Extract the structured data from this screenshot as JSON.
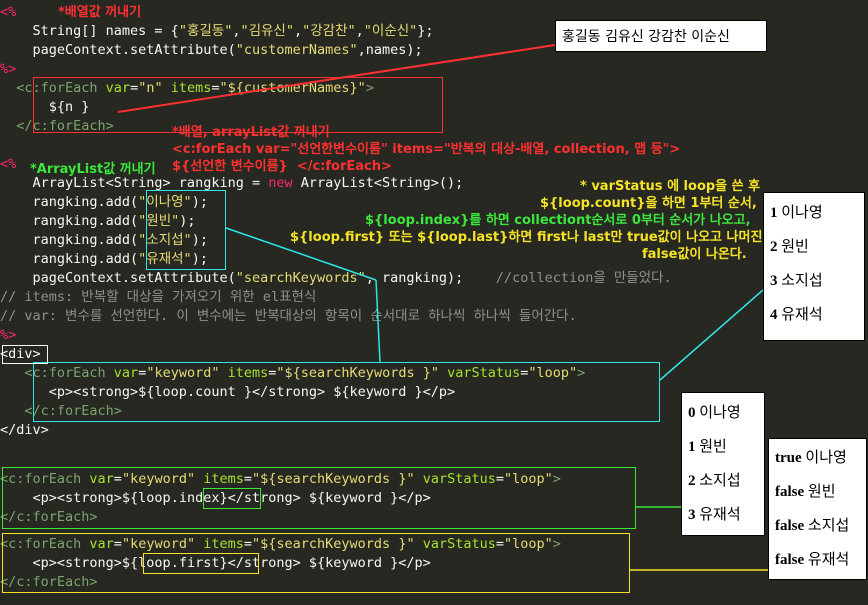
{
  "annotations": {
    "array_title": "*배열값 꺼내기",
    "foreach_title": "*배열, arrayList값 꺼내기",
    "foreach_syntax1": "<c:forEach var=\"선언한변수이름\" items=\"반복의 대상-배열, collection, 맵 등\">",
    "foreach_syntax2": "${선언한 변수이름}  </c:forEach>",
    "arraylist_title": "*ArrayList값 꺼내기",
    "varstatus1": "* varStatus 에 loop을 쓴 후",
    "varstatus2": "${loop.count}을 하면 1부터 순서,",
    "varstatus3": "${loop.index}를 하면 collectiont순서로 0부터 순서가 나오고,",
    "varstatus4": "${loop.first} 또는 ${loop.last}하면 first나 last만 true값이 나오고 나머진",
    "varstatus5": "false값이 나온다."
  },
  "code": {
    "l_open1": "<%",
    "l_names_a": "    String[] names = {",
    "l_names_s1": "\"홍길동\"",
    "l_names_s2": "\"김유신\"",
    "l_names_s3": "\"강감찬\"",
    "l_names_s4": "\"이순신\"",
    "l_names_end": "};",
    "l_setattr1_a": "    pageContext.setAttribute(",
    "l_setattr1_s": "\"customerNames\"",
    "l_setattr1_b": ",names);",
    "l_close1": "%>",
    "l_fe1_tag": "  <c:forEach ",
    "l_fe1_var": "var",
    "l_fe1_varval": "\"n\"",
    "l_fe1_items": " items",
    "l_fe1_itemsval": "\"${customerNames}\"",
    "l_fe1_end": ">",
    "l_fe1_body": "      ${n }",
    "l_fe1_close": "  </c:forEach>",
    "l_open2": "<%",
    "l_al_a": "    ArrayList<String> rangking = ",
    "l_al_new": "new",
    "l_al_b": " ArrayList<String>();",
    "l_add_a": "    rangking.add(",
    "l_add_v1": "\"이나영\"",
    "l_add_v2": "\"원빈\"",
    "l_add_v3": "\"소지섭\"",
    "l_add_v4": "\"유재석\"",
    "l_add_end": ");",
    "l_setattr2_a": "    pageContext.setAttribute(",
    "l_setattr2_s": "\"searchKeywords\"",
    "l_setattr2_b": ", rangking);",
    "l_setattr2_cmt": "    //collection을 만들었다.",
    "l_cmt1": "// items: 반복할 대상을 가져오기 위한 el표현식",
    "l_cmt2": "// var: 변수를 선언한다. 이 변수에는 반복대상의 항목이 순서대로 하나씩 하나씩 들어간다.",
    "l_close2": "%>",
    "l_div_open": "<div>",
    "l_fe2_tag": "   <c:forEach ",
    "l_fe_var": "var",
    "l_fe_varval": "\"keyword\"",
    "l_fe_items": " items",
    "l_fe_itemsval": "\"${searchKeywords }\"",
    "l_fe_vs": " varStatus",
    "l_fe_vsval": "\"loop\"",
    "l_fe_end": ">",
    "l_fe2_body_a": "      <p><strong>",
    "l_fe2_body_el": "${loop.count }",
    "l_fe2_body_b": "</strong> ",
    "l_fe2_body_el2": "${keyword }",
    "l_fe2_body_c": "</p>",
    "l_fe2_close": "   </c:forEach>",
    "l_div_close": "</div>",
    "l_fe3_tag": "<c:forEach ",
    "l_fe3_body_a": "    <p><strong>",
    "l_fe3_body_el": "${loop.index}",
    "l_fe3_body_b": "</strong> ",
    "l_fe3_body_el2": "${keyword }",
    "l_fe3_body_c": "</p>",
    "l_fe3_close": "</c:forEach>",
    "l_fe4_tag": "<c:forEach ",
    "l_fe4_body_a": "    <p><strong>",
    "l_fe4_body_el": "${loop.first}",
    "l_fe4_body_b": "</strong> ",
    "l_fe4_body_el2": "${keyword }",
    "l_fe4_body_c": "</p>",
    "l_fe4_close": "</c:forEach>"
  },
  "popups": {
    "names_output": "홍길동 김유신 강감찬 이순신",
    "count_output": [
      {
        "num": "1",
        "name": "이나영"
      },
      {
        "num": "2",
        "name": "원빈"
      },
      {
        "num": "3",
        "name": "소지섭"
      },
      {
        "num": "4",
        "name": "유재석"
      }
    ],
    "index_output": [
      {
        "num": "0",
        "name": "이나영"
      },
      {
        "num": "1",
        "name": "원빈"
      },
      {
        "num": "2",
        "name": "소지섭"
      },
      {
        "num": "3",
        "name": "유재석"
      }
    ],
    "first_output": [
      {
        "num": "true",
        "name": "이나영"
      },
      {
        "num": "false",
        "name": "원빈"
      },
      {
        "num": "false",
        "name": "소지섭"
      },
      {
        "num": "false",
        "name": "유재석"
      }
    ]
  },
  "colors": {
    "background": "#272822",
    "red": "#ff3030",
    "yellow": "#f5e326",
    "green": "#3ce73c",
    "cyan": "#2fe6e6"
  }
}
